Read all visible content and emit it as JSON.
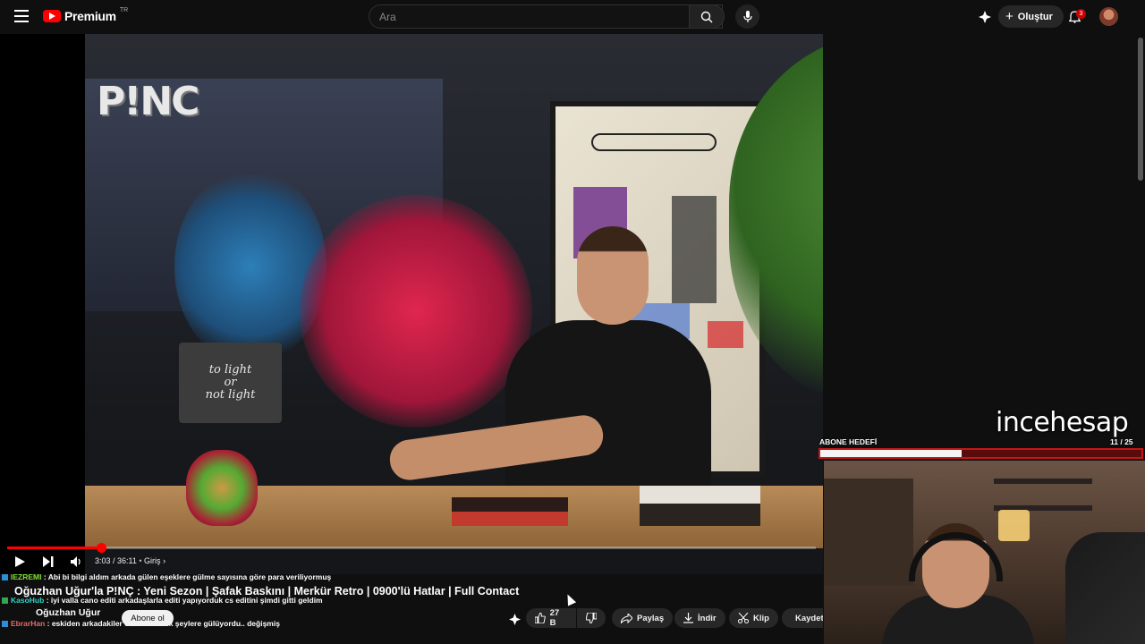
{
  "header": {
    "logo_text": "Premium",
    "region": "TR",
    "search_placeholder": "Ara",
    "create_label": "Oluştur",
    "notification_count": "3"
  },
  "video": {
    "watermark": "P!NC",
    "sign_lines": [
      "to light",
      "or",
      "not light"
    ],
    "title": "Oğuzhan Uğur'la P!NÇ : Yeni Sezon | Şafak Baskını | Merkür Retro | 0900'lü Hatlar | Full Contact",
    "channel": "Oğuzhan Uğur",
    "subscribe_label": "Abone ol",
    "player": {
      "time": "3:03 / 36:11",
      "chapter": "Giriş",
      "progress_fraction": 0.116
    }
  },
  "actions": {
    "like_count": "27 B",
    "share": "Paylaş",
    "download": "İndir",
    "clip": "Klip",
    "save": "Kaydet"
  },
  "chat": [
    {
      "user": "IEZREMI",
      "text": ": Abi bi bilgi aldım arkada gülen eşeklere gülme sayısına göre para veriliyormuş"
    },
    {
      "user": "KasoHub",
      "text": ": iyi valla cano editi arkadaşlarla editi yapıyorduk cs editini şimdi gitti geldim"
    },
    {
      "user": "EbrarHan",
      "text": ": eskiden arkadakiler cidden komik şeylere gülüyordu.. değişmiş"
    }
  ],
  "overlay": {
    "streamer_tag": "incehesap",
    "goal_label": "ABONE HEDEFİ",
    "goal_count": "11 / 25",
    "goal_fraction": 0.44
  },
  "colors": {
    "accent": "#ff0000",
    "background": "#0f0f0f",
    "goal_bar": "#c21818"
  }
}
